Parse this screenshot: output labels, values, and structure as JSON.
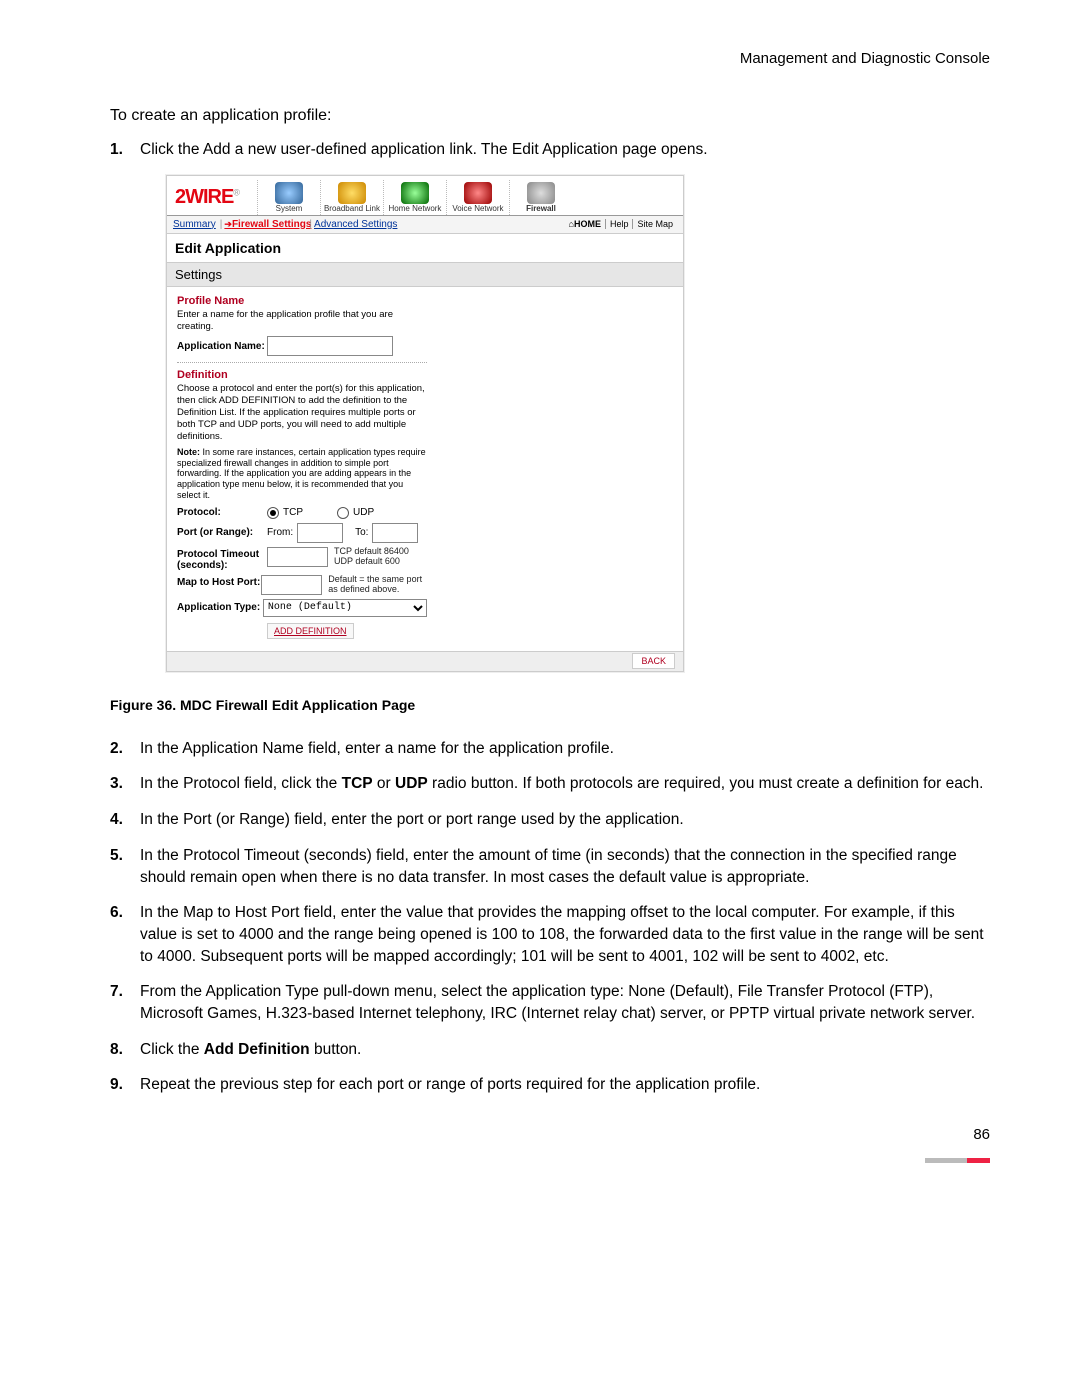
{
  "header": {
    "title": "Management and Diagnostic Console"
  },
  "intro": "To create an application profile:",
  "steps": [
    {
      "n": "1.",
      "html": "Click the Add a new user-defined application link. The Edit Application page opens."
    },
    {
      "n": "2.",
      "html": "In the Application Name field, enter a name for the application profile."
    },
    {
      "n": "3.",
      "html": "In the Protocol field, click the <b>TCP</b> or <b>UDP</b> radio button. If both protocols are required, you must create a definition for each."
    },
    {
      "n": "4.",
      "html": "In the Port (or Range) field, enter the port or port range used by the application."
    },
    {
      "n": "5.",
      "html": "In the Protocol Timeout (seconds) field, enter the amount of time (in seconds) that the connection in the specified range should remain open when there is no data transfer. In most cases the default value is appropriate."
    },
    {
      "n": "6.",
      "html": "In the Map to Host Port field, enter the value that provides the mapping offset to the local computer. For example, if this value is set to 4000 and the range being opened is 100 to 108, the forwarded data to the first value in the range will be sent to 4000. Subsequent ports will be mapped accordingly; 101 will be sent to 4001, 102 will be sent to 4002, etc."
    },
    {
      "n": "7.",
      "html": "From the Application Type pull-down menu, select the application type: None (Default), File Transfer Protocol (FTP), Microsoft Games, H.323-based Internet telephony, IRC (Internet relay chat) server, or PPTP virtual private network server."
    },
    {
      "n": "8.",
      "html": "Click the <b>Add Definition</b> button."
    },
    {
      "n": "9.",
      "html": "Repeat the previous step for each port or range of ports required for the application profile."
    }
  ],
  "figure_caption": "Figure 36. MDC Firewall Edit Application Page",
  "page_number": "86",
  "ui": {
    "logo": "2WIRE",
    "nav": {
      "system": "System",
      "broadband": "Broadband Link",
      "home_net": "Home Network",
      "voice_net": "Voice Network",
      "firewall": "Firewall"
    },
    "subnav": {
      "summary": "Summary",
      "firewall_settings": "Firewall Settings",
      "advanced_settings": "Advanced Settings",
      "home": "HOME",
      "help": "Help",
      "sitemap": "Site Map"
    },
    "page_title": "Edit Application",
    "settings_label": "Settings",
    "profile": {
      "heading": "Profile Name",
      "desc": "Enter a name for the application profile that you are creating.",
      "field_label": "Application Name:"
    },
    "definition": {
      "heading": "Definition",
      "desc": "Choose a protocol and enter the port(s) for this application, then click ADD DEFINITION to add the definition to the Definition List. If the application requires multiple ports or both TCP and UDP ports, you will need to add multiple definitions.",
      "note": "In some rare instances, certain application types require specialized firewall changes in addition to simple port forwarding. If the application you are adding appears in the application type menu below, it is recommended that you select it.",
      "note_label": "Note:",
      "protocol_label": "Protocol:",
      "tcp": "TCP",
      "udp": "UDP",
      "port_label": "Port (or Range):",
      "from": "From:",
      "to": "To:",
      "timeout_label": "Protocol Timeout (seconds):",
      "timeout_hint1": "TCP default 86400",
      "timeout_hint2": "UDP default 600",
      "map_label": "Map to Host Port:",
      "map_hint": "Default = the same port as defined above.",
      "apptype_label": "Application Type:",
      "apptype_value": "None (Default)",
      "add_btn": "ADD DEFINITION",
      "back_btn": "BACK"
    }
  }
}
